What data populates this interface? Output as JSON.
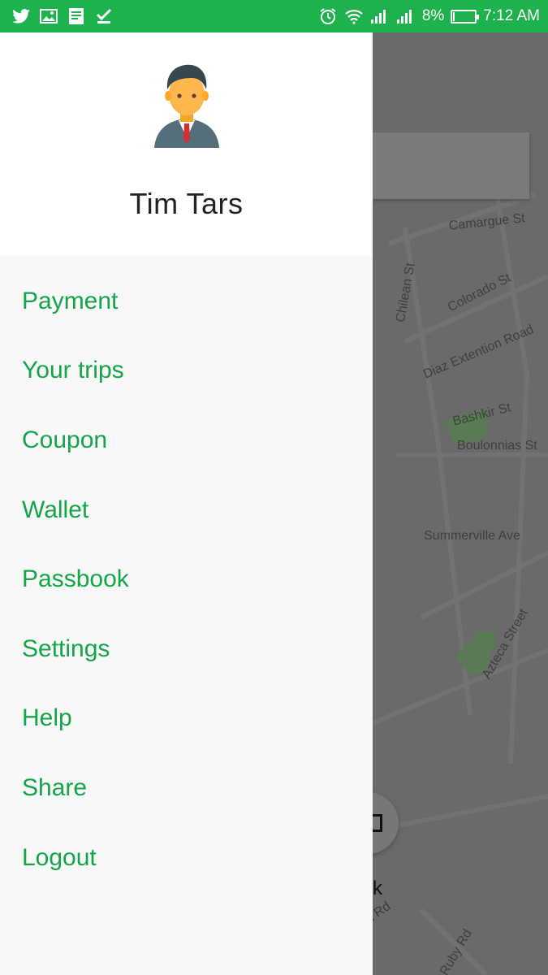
{
  "status_bar": {
    "battery_percent": "8%",
    "time": "7:12 AM",
    "background_color": "#1db24c",
    "left_icons": [
      "twitter-icon",
      "gallery-icon",
      "book-icon",
      "checkmark-icon"
    ],
    "right_icons": [
      "alarm-icon",
      "wifi-icon",
      "signal-icon",
      "signal-icon-2",
      "battery-icon"
    ],
    "battery_level": 0.08
  },
  "drawer": {
    "user_name": "Tim Tars",
    "menu_color": "#13a649",
    "menu": [
      {
        "id": "payment",
        "label": "Payment"
      },
      {
        "id": "your-trips",
        "label": "Your trips"
      },
      {
        "id": "coupon",
        "label": "Coupon"
      },
      {
        "id": "wallet",
        "label": "Wallet"
      },
      {
        "id": "passbook",
        "label": "Passbook"
      },
      {
        "id": "settings",
        "label": "Settings"
      },
      {
        "id": "help",
        "label": "Help"
      },
      {
        "id": "share",
        "label": "Share"
      },
      {
        "id": "logout",
        "label": "Logout"
      }
    ]
  },
  "map": {
    "streets": [
      "Camargue St",
      "Chilean St",
      "Colorado St",
      "Diaz Extention Road",
      "Bashkir St",
      "Boulonnias St",
      "Summerville Ave",
      "Azteca Street",
      "Ruby Rd"
    ],
    "partial_label": "k",
    "partial_road": "n Rd"
  }
}
